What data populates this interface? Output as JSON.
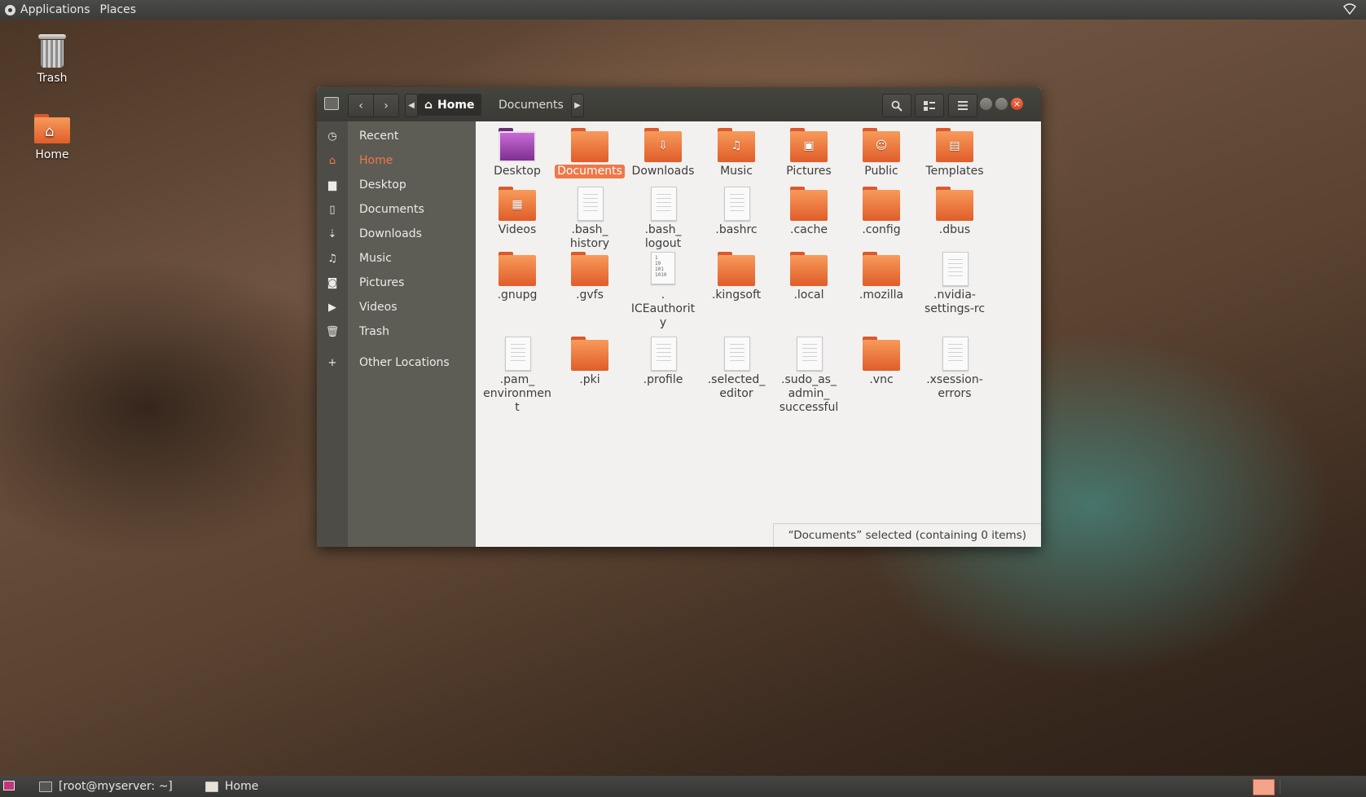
{
  "top_panel": {
    "applications": "Applications",
    "places": "Places",
    "network_icon": "wifi-icon"
  },
  "desktop": {
    "trash_label": "Trash",
    "home_label": "Home"
  },
  "window": {
    "breadcrumbs": [
      {
        "label": "Home",
        "icon": "home-icon"
      },
      {
        "label": "Documents"
      }
    ],
    "sidebar": [
      {
        "label": "Recent",
        "icon": "clock-icon",
        "glyph": "◷"
      },
      {
        "label": "Home",
        "icon": "home-icon",
        "glyph": "⌂"
      },
      {
        "label": "Desktop",
        "icon": "folder-icon",
        "glyph": "▆"
      },
      {
        "label": "Documents",
        "icon": "document-icon",
        "glyph": "▯"
      },
      {
        "label": "Downloads",
        "icon": "download-icon",
        "glyph": "⇣"
      },
      {
        "label": "Music",
        "icon": "music-icon",
        "glyph": "♫"
      },
      {
        "label": "Pictures",
        "icon": "camera-icon",
        "glyph": "◙"
      },
      {
        "label": "Videos",
        "icon": "video-icon",
        "glyph": "▶"
      },
      {
        "label": "Trash",
        "icon": "trash-icon",
        "glyph": "🗑"
      },
      {
        "label": "Other Locations",
        "icon": "plus-icon",
        "glyph": "+"
      }
    ],
    "active_sidebar": "Home",
    "files": [
      {
        "name": "Desktop",
        "type": "desktop"
      },
      {
        "name": "Documents",
        "type": "folder",
        "selected": true
      },
      {
        "name": "Downloads",
        "type": "folder",
        "tag": "⇩"
      },
      {
        "name": "Music",
        "type": "folder",
        "tag": "♫"
      },
      {
        "name": "Pictures",
        "type": "folder",
        "tag": "▣"
      },
      {
        "name": "Public",
        "type": "folder",
        "tag": "☺"
      },
      {
        "name": "Templates",
        "type": "folder",
        "tag": "▤"
      },
      {
        "name": "Videos",
        "type": "folder",
        "tag": "▦"
      },
      {
        "name": ".bash_\nhistory",
        "type": "doc"
      },
      {
        "name": ".bash_\nlogout",
        "type": "doc"
      },
      {
        "name": ".bashrc",
        "type": "doc"
      },
      {
        "name": ".cache",
        "type": "folder"
      },
      {
        "name": ".config",
        "type": "folder"
      },
      {
        "name": ".dbus",
        "type": "folder"
      },
      {
        "name": ".gnupg",
        "type": "folder"
      },
      {
        "name": ".gvfs",
        "type": "folder"
      },
      {
        "name": ".\nICEauthorit\ny",
        "type": "binary",
        "bin_text": "1\n10\n101\n1010"
      },
      {
        "name": ".kingsoft",
        "type": "folder"
      },
      {
        "name": ".local",
        "type": "folder"
      },
      {
        "name": ".mozilla",
        "type": "folder"
      },
      {
        "name": ".nvidia-\nsettings-rc",
        "type": "doc"
      },
      {
        "name": ".pam_\nenvironmen\nt",
        "type": "doc"
      },
      {
        "name": ".pki",
        "type": "folder"
      },
      {
        "name": ".profile",
        "type": "doc"
      },
      {
        "name": ".selected_\neditor",
        "type": "doc"
      },
      {
        "name": ".sudo_as_\nadmin_\nsuccessful",
        "type": "doc"
      },
      {
        "name": ".vnc",
        "type": "folder"
      },
      {
        "name": ".xsession-\nerrors",
        "type": "doc"
      }
    ],
    "status": "“Documents” selected  (containing 0 items)"
  },
  "bottom_panel": {
    "tasks": [
      {
        "label": "[root@myserver: ~]",
        "icon": "terminal-icon"
      },
      {
        "label": "Home",
        "icon": "file-manager-icon"
      }
    ]
  },
  "colors": {
    "accent": "#f07746",
    "folder_top": "#f79a5a",
    "folder_bottom": "#e05d2a",
    "sidebar_bg": "#5d5c55",
    "header_bg": "#3b3a36"
  }
}
